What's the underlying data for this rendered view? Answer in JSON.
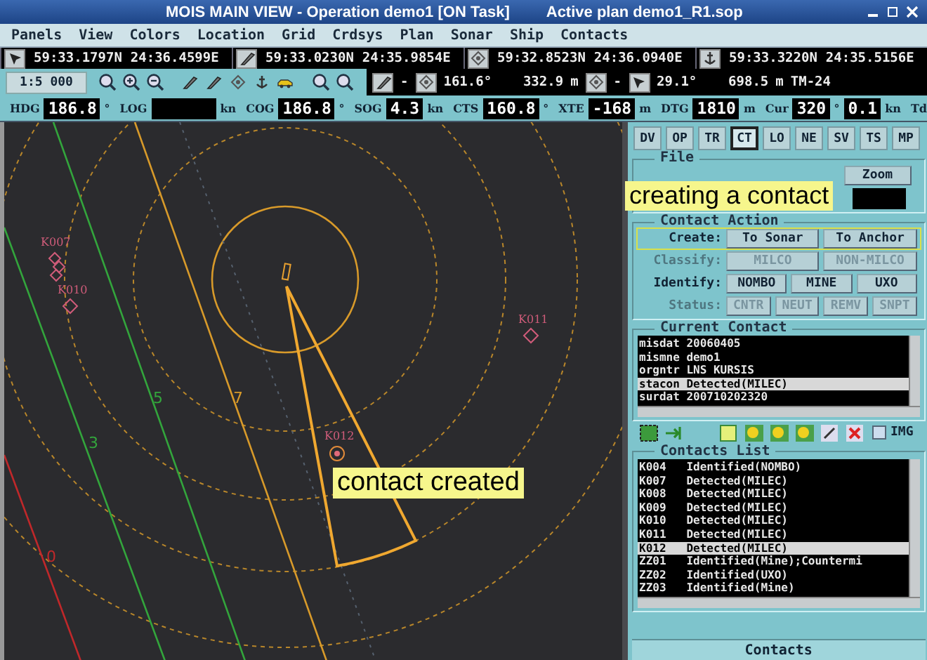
{
  "window": {
    "title": "MOIS MAIN VIEW - Operation demo1 [ON Task]",
    "plan": "Active plan demo1_R1.sop"
  },
  "menu": [
    "Panels",
    "View",
    "Colors",
    "Location",
    "Grid",
    "Crdsys",
    "Plan",
    "Sonar",
    "Ship",
    "Contacts"
  ],
  "positions": [
    {
      "lat": "59:33.1797N",
      "lon": "24:36.4599E"
    },
    {
      "lat": "59:33.0230N",
      "lon": "24:35.9854E"
    },
    {
      "lat": "59:32.8523N",
      "lon": "24:36.0940E"
    },
    {
      "lat": "59:33.3220N",
      "lon": "24:35.5156E"
    }
  ],
  "toolbar": {
    "scale": "1:5 000",
    "legs": [
      {
        "sep": "-",
        "bearing": "161.6°",
        "distance": "332.9",
        "unit": "m"
      },
      {
        "sep": "-",
        "bearing": "29.1°",
        "distance": "698.5",
        "unit": "m"
      }
    ],
    "projection": "TM-24"
  },
  "nav": [
    {
      "label": "HDG",
      "value": "186.8",
      "unit": "°"
    },
    {
      "label": "LOG",
      "unit": "kn"
    },
    {
      "label": "COG",
      "value": "186.8",
      "unit": "°"
    },
    {
      "label": "SOG",
      "value": "4.3",
      "unit": "kn"
    },
    {
      "label": "CTS",
      "value": "160.8",
      "unit": "°"
    },
    {
      "label": "XTE",
      "value": "-168",
      "unit": "m"
    },
    {
      "label": "DTG",
      "value": "1810",
      "unit": "m"
    },
    {
      "label": "Cur",
      "value": "320",
      "unit": "°"
    },
    {
      "value": "0.1",
      "unit": "kn"
    },
    {
      "label": "Td"
    }
  ],
  "map": {
    "depth_labels": [
      {
        "text": "5",
        "kind": "green"
      },
      {
        "text": "3",
        "kind": "green"
      },
      {
        "text": "7",
        "kind": "orange"
      },
      {
        "text": "0",
        "kind": "red"
      }
    ],
    "contacts": [
      {
        "label": "K007",
        "kind": "cluster"
      },
      {
        "label": "K010",
        "kind": "diamond"
      },
      {
        "label": "K011",
        "kind": "diamond"
      },
      {
        "label": "K012",
        "kind": "target"
      }
    ],
    "callout": "contact created"
  },
  "panel": {
    "tabs": [
      {
        "label": "DV",
        "selected": false
      },
      {
        "label": "OP",
        "selected": false
      },
      {
        "label": "TR",
        "selected": false
      },
      {
        "label": "CT",
        "selected": true
      },
      {
        "label": "LO",
        "selected": false
      },
      {
        "label": "NE",
        "selected": false
      },
      {
        "label": "SV",
        "selected": false
      },
      {
        "label": "TS",
        "selected": false
      },
      {
        "label": "MP",
        "selected": false
      }
    ],
    "file": {
      "legend": "File",
      "zoom": "Zoom"
    },
    "callout": "creating a contact",
    "contact_action": {
      "legend": "Contact Action",
      "rows": [
        {
          "label": "Create:",
          "disabled": false,
          "highlighted": true,
          "buttons": [
            "To Sonar",
            "To Anchor"
          ]
        },
        {
          "label": "Classify:",
          "disabled": true,
          "highlighted": false,
          "buttons": [
            "MILCO",
            "NON-MILCO"
          ]
        },
        {
          "label": "Identify:",
          "disabled": false,
          "highlighted": false,
          "buttons": [
            "NOMBO",
            "MINE",
            "UXO"
          ]
        },
        {
          "label": "Status:",
          "disabled": true,
          "highlighted": false,
          "buttons": [
            "CNTR",
            "NEUT",
            "REMV",
            "SNPT"
          ]
        }
      ]
    },
    "current_contact": {
      "legend": "Current Contact",
      "lines": [
        {
          "text": "misdat 20060405",
          "selected": false
        },
        {
          "text": "mismne demo1",
          "selected": false
        },
        {
          "text": "orgntr LNS KURSIS",
          "selected": false
        },
        {
          "text": "stacon Detected(MILEC)",
          "selected": true
        },
        {
          "text": "surdat 200710202320",
          "selected": false
        }
      ]
    },
    "img": {
      "label": "IMG",
      "checked": false
    },
    "contacts_list": {
      "legend": "Contacts List",
      "items": [
        {
          "id": "K004",
          "status": "Identified(NOMBO)",
          "selected": false
        },
        {
          "id": "K007",
          "status": "Detected(MILEC)",
          "selected": false
        },
        {
          "id": "K008",
          "status": "Detected(MILEC)",
          "selected": false
        },
        {
          "id": "K009",
          "status": "Detected(MILEC)",
          "selected": false
        },
        {
          "id": "K010",
          "status": "Detected(MILEC)",
          "selected": false
        },
        {
          "id": "K011",
          "status": "Detected(MILEC)",
          "selected": false
        },
        {
          "id": "K012",
          "status": "Detected(MILEC)",
          "selected": true
        },
        {
          "id": "ZZ01",
          "status": "Identified(Mine);Countermi",
          "selected": false
        },
        {
          "id": "ZZ02",
          "status": "Identified(UXO)",
          "selected": false
        },
        {
          "id": "ZZ03",
          "status": "Identified(Mine)",
          "selected": false
        }
      ]
    },
    "footer": "Contacts"
  }
}
